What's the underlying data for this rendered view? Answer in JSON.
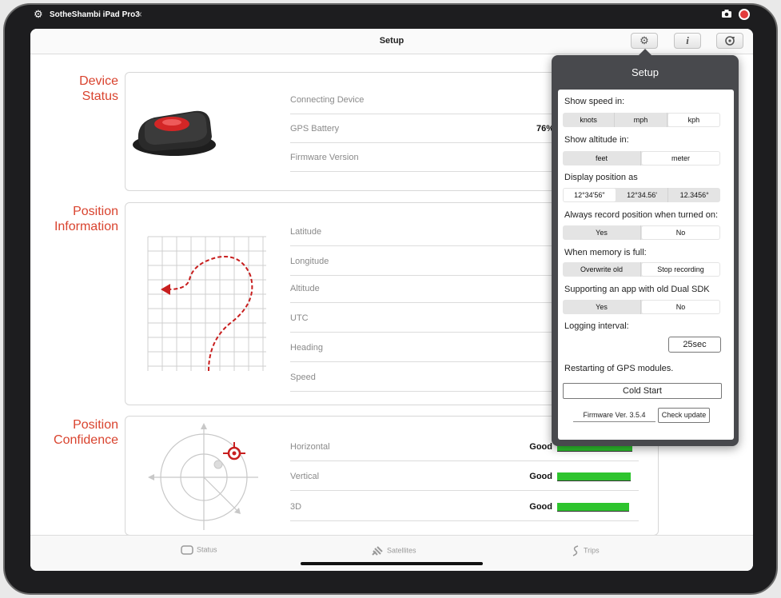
{
  "titlebar": {
    "app_name": "SotheShambi iPad Pro3",
    "close": "×"
  },
  "nav": {
    "title": "Setup",
    "info_label": "i"
  },
  "sections": {
    "device_status": {
      "label_line1": "Device",
      "label_line2": "Status"
    },
    "position_information": {
      "label_line1": "Position",
      "label_line2": "Information"
    },
    "position_confidence": {
      "label_line1": "Position",
      "label_line2": "Confidence"
    }
  },
  "device_rows": [
    {
      "label": "Connecting Device",
      "value": ""
    },
    {
      "label": "GPS Battery",
      "value": "76%"
    },
    {
      "label": "Firmware Version",
      "value": ""
    }
  ],
  "position_rows": [
    {
      "label": "Latitude"
    },
    {
      "label": "Longitude"
    },
    {
      "label": "Altitude"
    },
    {
      "label": "UTC"
    },
    {
      "label": "Heading"
    },
    {
      "label": "Speed"
    }
  ],
  "confidence_rows": [
    {
      "label": "Horizontal",
      "value": "Good",
      "level": 0.92
    },
    {
      "label": "Vertical",
      "value": "Good",
      "level": 0.9
    },
    {
      "label": "3D",
      "value": "Good",
      "level": 0.88
    }
  ],
  "tabs": [
    {
      "label": "Status",
      "icon": "status-icon"
    },
    {
      "label": "Satellites",
      "icon": "satellite-icon"
    },
    {
      "label": "Trips",
      "icon": "trips-icon"
    }
  ],
  "popover": {
    "title": "Setup",
    "speed": {
      "label": "Show speed in:",
      "options": [
        "knots",
        "mph",
        "kph"
      ],
      "selected": "kph"
    },
    "altitude": {
      "label": "Show altitude in:",
      "options": [
        "feet",
        "meter"
      ],
      "selected": "meter"
    },
    "position": {
      "label": "Display position as",
      "options": [
        "12°34'56\"",
        "12°34.56'",
        "12.3456°"
      ],
      "selected": "12°34'56\""
    },
    "record": {
      "label": "Always record position when turned on:",
      "options": [
        "Yes",
        "No"
      ],
      "selected": "No"
    },
    "memory": {
      "label": "When memory is full:",
      "options": [
        "Overwrite old",
        "Stop recording"
      ],
      "selected": "Stop recording"
    },
    "sdk": {
      "label": "Supporting an app with old Dual SDK",
      "options": [
        "Yes",
        "No"
      ],
      "selected": "No"
    },
    "logging": {
      "label": "Logging interval:",
      "value": "25sec"
    },
    "restart": {
      "label": "Restarting of GPS modules.",
      "button": "Cold Start"
    },
    "firmware": {
      "text": "Firmware Ver. 3.5.4",
      "button": "Check update"
    }
  },
  "colors": {
    "accent": "#d9432e",
    "good_bar": "#2ec42e",
    "popover_bg": "#48494d"
  }
}
